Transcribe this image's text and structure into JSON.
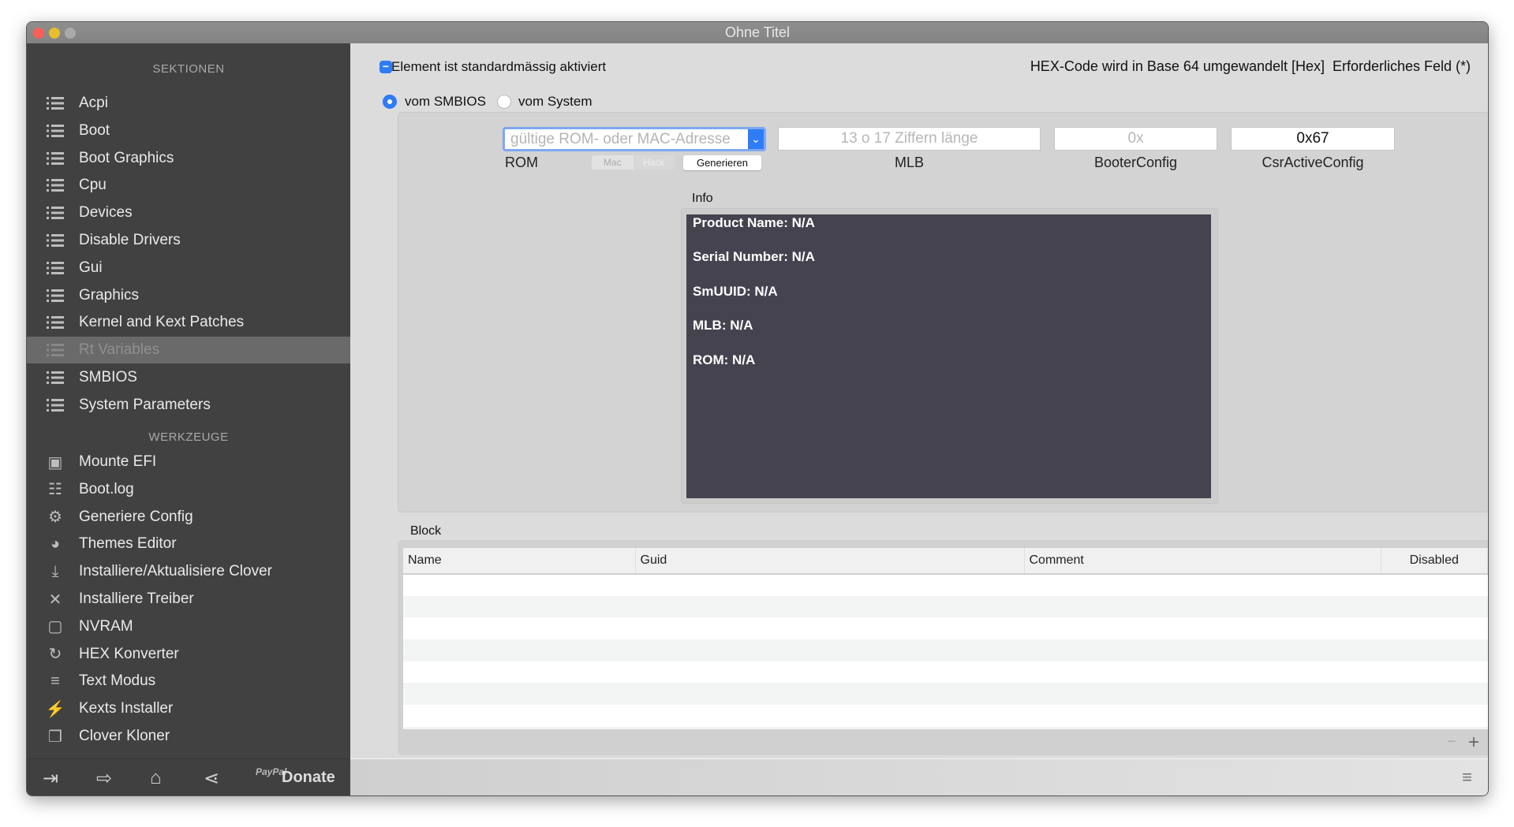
{
  "window": {
    "title": "Ohne Titel"
  },
  "sidebar": {
    "sections_header": "SEKTIONEN",
    "sections": [
      {
        "label": "Acpi",
        "icon": "list-icon"
      },
      {
        "label": "Boot",
        "icon": "list-icon"
      },
      {
        "label": "Boot Graphics",
        "icon": "list-icon"
      },
      {
        "label": "Cpu",
        "icon": "list-icon"
      },
      {
        "label": "Devices",
        "icon": "list-icon"
      },
      {
        "label": "Disable Drivers",
        "icon": "list-icon"
      },
      {
        "label": "Gui",
        "icon": "list-icon"
      },
      {
        "label": "Graphics",
        "icon": "list-icon"
      },
      {
        "label": "Kernel and Kext Patches",
        "icon": "list-icon"
      },
      {
        "label": "Rt Variables",
        "icon": "list-icon",
        "selected": true
      },
      {
        "label": "SMBIOS",
        "icon": "list-icon"
      },
      {
        "label": "System Parameters",
        "icon": "list-icon"
      }
    ],
    "tools_header": "WERKZEUGE",
    "tools": [
      {
        "label": "Mounte EFI",
        "icon": "disk-icon",
        "glyph": "▣"
      },
      {
        "label": "Boot.log",
        "icon": "log-search-icon",
        "glyph": "☷"
      },
      {
        "label": "Generiere Config",
        "icon": "gears-icon",
        "glyph": "⚙"
      },
      {
        "label": "Themes Editor",
        "icon": "palette-icon",
        "glyph": "◕"
      },
      {
        "label": "Installiere/Aktualisiere Clover",
        "icon": "download-icon",
        "glyph": "⤓"
      },
      {
        "label": "Installiere Treiber",
        "icon": "tools-icon",
        "glyph": "✕"
      },
      {
        "label": "NVRAM",
        "icon": "chip-icon",
        "glyph": "▢"
      },
      {
        "label": "HEX Konverter",
        "icon": "refresh-icon",
        "glyph": "↻"
      },
      {
        "label": "Text Modus",
        "icon": "text-icon",
        "glyph": "≡"
      },
      {
        "label": "Kexts Installer",
        "icon": "plug-icon",
        "glyph": "⚡"
      },
      {
        "label": "Clover Kloner",
        "icon": "clone-icon",
        "glyph": "❐"
      }
    ],
    "bottom": {
      "paypal_logo": "PayPal",
      "donate": "Donate"
    }
  },
  "main": {
    "enabled_checkbox": "Element ist standardmässig aktiviert",
    "hex_note": "HEX-Code wird in Base 64 umgewandelt [Hex]",
    "required_note": "Erforderliches Feld (*)",
    "radio_smbios": "vom SMBIOS",
    "radio_system": "vom System",
    "rom": {
      "placeholder": "gültige ROM- oder MAC-Adresse",
      "label": "ROM",
      "seg_mac": "Mac",
      "seg_hack": "Hack",
      "generate": "Generieren"
    },
    "mlb": {
      "placeholder": "13 o 17 Ziffern länge",
      "label": "MLB"
    },
    "booter": {
      "placeholder": "0x",
      "label": "BooterConfig"
    },
    "csr": {
      "value": "0x67",
      "label": "CsrActiveConfig"
    },
    "info": {
      "label": "Info",
      "lines": [
        "Product Name: N/A",
        "Serial Number: N/A",
        "SmUUID: N/A",
        "MLB: N/A",
        "ROM: N/A"
      ]
    },
    "block": {
      "label": "Block",
      "columns": [
        "Name",
        "Guid",
        "Comment",
        "Disabled"
      ],
      "remove": "−",
      "add": "+"
    }
  }
}
